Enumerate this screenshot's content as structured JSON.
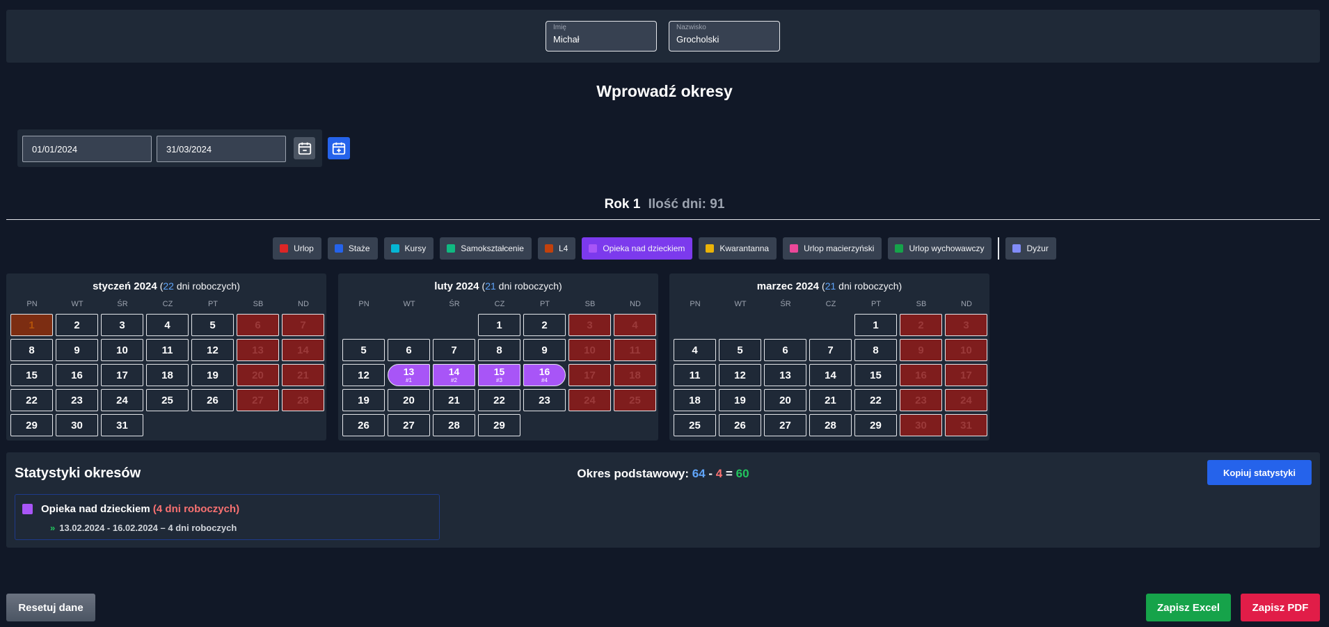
{
  "header": {
    "first_name": {
      "label": "Imię",
      "value": "Michał"
    },
    "last_name": {
      "label": "Nazwisko",
      "value": "Grocholski"
    }
  },
  "page_title": "Wprowadź okresy",
  "period": {
    "start": "01/01/2024",
    "end": "31/03/2024"
  },
  "icons": {
    "remove_period": "calendar-minus-icon",
    "add_period": "calendar-plus-icon"
  },
  "year": {
    "label": "Rok 1",
    "days_label": "Ilość dni:",
    "days": "91"
  },
  "legend": [
    {
      "label": "Urlop",
      "color": "#dc2626"
    },
    {
      "label": "Staże",
      "color": "#2563eb"
    },
    {
      "label": "Kursy",
      "color": "#06b6d4"
    },
    {
      "label": "Samokształcenie",
      "color": "#10b981"
    },
    {
      "label": "L4",
      "color": "#c2410c"
    },
    {
      "label": "Opieka nad dzieckiem",
      "color": "#a855f7",
      "active": true
    },
    {
      "label": "Kwarantanna",
      "color": "#eab308"
    },
    {
      "label": "Urlop macierzyński",
      "color": "#ec4899"
    },
    {
      "label": "Urlop wychowawczy",
      "color": "#16a34a"
    },
    {
      "label": "Dyżur",
      "color": "#818cf8"
    }
  ],
  "weekdays": [
    "PN",
    "WT",
    "ŚR",
    "CZ",
    "PT",
    "SB",
    "ND"
  ],
  "months": [
    {
      "name": "styczeń 2024",
      "workdays": "22",
      "workdays_suffix": "dni roboczych)",
      "offset": 0,
      "days": 31,
      "holidays": [
        1
      ],
      "marked": []
    },
    {
      "name": "luty 2024",
      "workdays": "21",
      "workdays_suffix": "dni roboczych)",
      "offset": 3,
      "days": 29,
      "holidays": [],
      "marked": [
        {
          "day": 13,
          "tag": "#1"
        },
        {
          "day": 14,
          "tag": "#2"
        },
        {
          "day": 15,
          "tag": "#3"
        },
        {
          "day": 16,
          "tag": "#4"
        }
      ]
    },
    {
      "name": "marzec 2024",
      "workdays": "21",
      "workdays_suffix": "dni roboczych)",
      "offset": 4,
      "days": 31,
      "holidays": [],
      "marked": []
    }
  ],
  "stats": {
    "title": "Statystyki okresów",
    "basic_label": "Okres podstawowy:",
    "basic_total": "64",
    "basic_minus": "4",
    "basic_result": "60",
    "copy_label": "Kopiuj statystyki",
    "entry": {
      "name": "Opieka nad dzieckiem",
      "count": "(4 dni roboczych)",
      "range": "13.02.2024 - 16.02.2024 – 4 dni roboczych",
      "color": "#a855f7"
    }
  },
  "footer": {
    "reset": "Resetuj dane",
    "excel": "Zapisz Excel",
    "pdf": "Zapisz PDF"
  }
}
